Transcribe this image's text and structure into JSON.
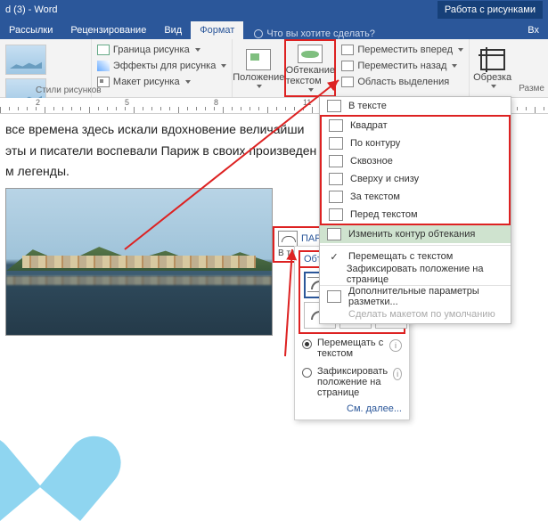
{
  "titlebar": {
    "title": "d (3) - Word",
    "context": "Работа с рисунками"
  },
  "tabs": {
    "t1": "Рассылки",
    "t2": "Рецензирование",
    "t3": "Вид",
    "t4": "Формат",
    "tellme": "Что вы хотите сделать?",
    "right": "Вх"
  },
  "ribbon": {
    "border": "Граница рисунка",
    "effects": "Эффекты для рисунка",
    "layout": "Макет рисунка",
    "gallery_label": "Стили рисунков",
    "position": "Положение",
    "wrap": "Обтекание текстом",
    "forward": "Переместить вперед",
    "backward": "Переместить назад",
    "selpane": "Область выделения",
    "crop": "Обрезка",
    "size_label": "Разме"
  },
  "menu": {
    "inline": "В тексте",
    "square": "Квадрат",
    "tight": "По контуру",
    "through": "Сквозное",
    "topbottom": "Сверху и снизу",
    "behind": "За текстом",
    "front": "Перед текстом",
    "edit": "Изменить контур обтекания",
    "movewith": "Перемещать с текстом",
    "fixpos": "Зафиксировать положение на странице",
    "moreopts": "Дополнительные параметры разметки...",
    "default": "Сделать макетом по умолчанию"
  },
  "panel": {
    "title": "Обтекание текстом",
    "movewith": "Перемещать с текстом",
    "fixpos": "Зафиксировать положение на странице",
    "more": "См. далее..."
  },
  "callout": {
    "heading": "ПАРА",
    "sub": "В те"
  },
  "doc": {
    "p1": "все времена здесь искали вдохновение величайши",
    "p2": "эты и писатели воспевали Париж в своих произведен",
    "p3": "м легенды."
  }
}
